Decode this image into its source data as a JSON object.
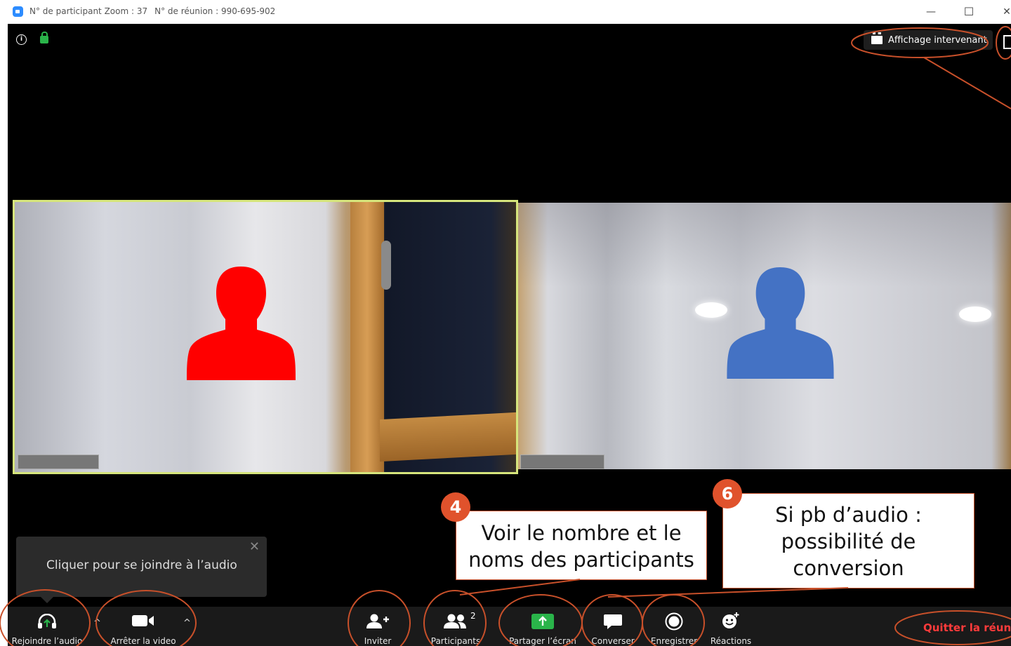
{
  "window": {
    "participant_id": "N° de participant Zoom : 37",
    "meeting_id": "N° de réunion : 990-695-902",
    "minimize": "—",
    "maximize": "☐",
    "close": "✕"
  },
  "header": {
    "speaker_view_label": "Affichage intervenant",
    "info_icon_glyph": "i"
  },
  "toast": {
    "text": "Cliquer pour se joindre à l’audio",
    "close": "✕"
  },
  "toolbar": {
    "join_audio": "Rejoindre l’audio",
    "stop_video": "Arrêter la video",
    "invite": "Inviter",
    "participants": "Participants",
    "participants_count": "2",
    "share_screen": "Partager l’écran",
    "chat": "Converser",
    "record": "Enregistrer",
    "reactions": "Réactions",
    "leave": "Quitter la réunion",
    "caret": "^"
  },
  "annotations": {
    "badge4": "4",
    "note4_line1": "Voir le nombre et le",
    "note4_line2": "noms des participants",
    "badge6": "6",
    "note6_line1": "Si pb d’audio :",
    "note6_line2": "possibilité de",
    "note6_line3": "conversion"
  },
  "colors": {
    "annotation_orange": "#c8502a",
    "badge_orange": "#e0522c",
    "active_speaker_border": "#d6e57c",
    "participant1_silhouette": "#ff0000",
    "participant2_silhouette": "#4472c4",
    "leave_red": "#ff3b3b",
    "share_green": "#2ab44a"
  }
}
